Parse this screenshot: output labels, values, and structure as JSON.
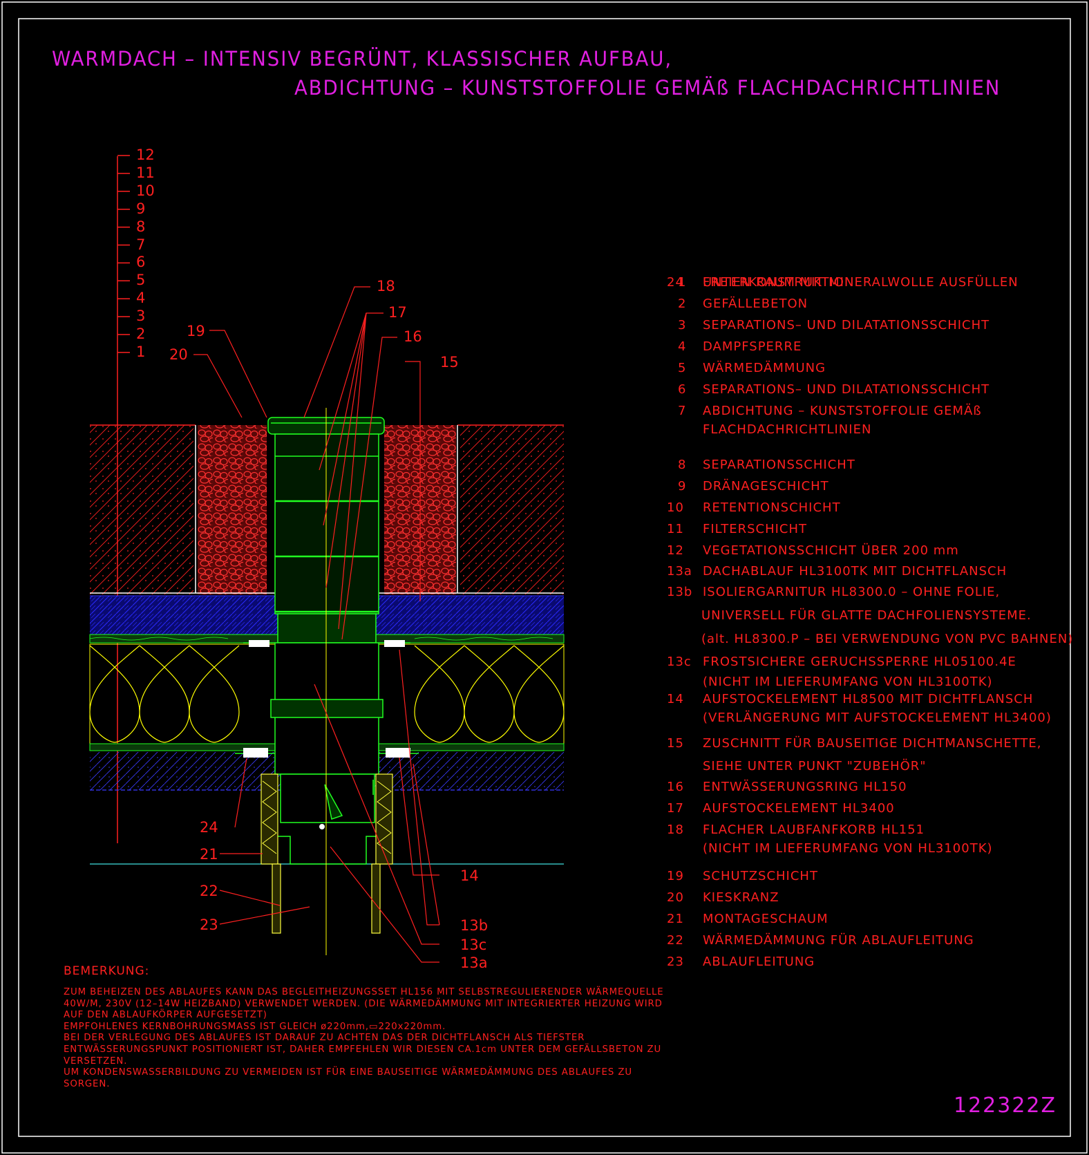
{
  "title": {
    "line1": "WARMDACH – INTENSIV BEGRÜNT, KLASSISCHER AUFBAU,",
    "line2": "ABDICHTUNG – KUNSTSTOFFOLIE GEMÄß FLACHDACHRICHTLINIEN"
  },
  "layer_scale_labels": [
    "12",
    "11",
    "10",
    "9",
    "8",
    "7",
    "6",
    "5",
    "4",
    "3",
    "2",
    "1"
  ],
  "callout_labels": [
    "18",
    "17",
    "16",
    "15",
    "19",
    "20",
    "24",
    "21",
    "22",
    "23",
    "14",
    "13b",
    "13c",
    "13a"
  ],
  "legend": [
    {
      "num": "1",
      "lines": [
        "UNTERKONSTRUKTION"
      ]
    },
    {
      "num": "2",
      "lines": [
        "GEFÄLLEBETON"
      ]
    },
    {
      "num": "3",
      "lines": [
        "SEPARATIONS– UND DILATATIONSSCHICHT"
      ]
    },
    {
      "num": "4",
      "lines": [
        "DAMPFSPERRE"
      ]
    },
    {
      "num": "5",
      "lines": [
        "WÄRMEDÄMMUNG"
      ]
    },
    {
      "num": "6",
      "lines": [
        "SEPARATIONS– UND DILATATIONSSCHICHT"
      ]
    },
    {
      "num": "7",
      "lines": [
        "ABDICHTUNG – KUNSTSTOFFOLIE GEMÄß",
        "FLACHDACHRICHTLINIEN"
      ]
    },
    {
      "num": "8",
      "lines": [
        "SEPARATIONSSCHICHT"
      ]
    },
    {
      "num": "9",
      "lines": [
        "DRÄNAGESCHICHT"
      ]
    },
    {
      "num": "10",
      "lines": [
        "RETENTIONSCHICHT"
      ]
    },
    {
      "num": "11",
      "lines": [
        "FILTERSCHICHT"
      ]
    },
    {
      "num": "12",
      "lines": [
        "VEGETATIONSSCHICHT ÜBER 200 mm"
      ]
    },
    {
      "num": "13a",
      "lines": [
        "DACHABLAUF HL3100TK MIT DICHTFLANSCH"
      ]
    },
    {
      "num": "13b",
      "lines": [
        "ISOLIERGARNITUR HL8300.0 – OHNE FOLIE,",
        "UNIVERSELL FÜR GLATTE DACHFOLIENSYSTEME.",
        "(alt. HL8300.P – BEI VERWENDUNG VON PVC BAHNEN)"
      ]
    },
    {
      "num": "13c",
      "lines": [
        "FROSTSICHERE GERUCHSSPERRE HL05100.4E",
        "(NICHT IM LIEFERUMFANG VON HL3100TK)"
      ]
    },
    {
      "num": "14",
      "lines": [
        "AUFSTOCKELEMENT HL8500 MIT DICHTFLANSCH",
        "(VERLÄNGERUNG MIT AUFSTOCKELEMENT HL3400)"
      ]
    },
    {
      "num": "15",
      "lines": [
        "ZUSCHNITT FÜR BAUSEITIGE DICHTMANSCHETTE,",
        "SIEHE UNTER PUNKT \"ZUBEHÖR\""
      ]
    },
    {
      "num": "16",
      "lines": [
        "ENTWÄSSERUNGSRING HL150"
      ]
    },
    {
      "num": "17",
      "lines": [
        "AUFSTOCKELEMENT HL3400"
      ]
    },
    {
      "num": "18",
      "lines": [
        "FLACHER LAUBFANFKORB HL151",
        "(NICHT IM LIEFERUMFANG VON HL3100TK)"
      ]
    },
    {
      "num": "19",
      "lines": [
        "SCHUTZSCHICHT"
      ]
    },
    {
      "num": "20",
      "lines": [
        "KIESKRANZ"
      ]
    },
    {
      "num": "21",
      "lines": [
        "MONTAGESCHAUM"
      ]
    },
    {
      "num": "22",
      "lines": [
        "WÄRMEDÄMMUNG FÜR ABLAUFLEITUNG"
      ]
    },
    {
      "num": "23",
      "lines": [
        "ABLAUFLEITUNG"
      ]
    },
    {
      "num": "24",
      "lines": [
        "FREIEN RAUM MIT MINERALWOLLE AUSFÜLLEN"
      ]
    }
  ],
  "remark": {
    "title": "BEMERKUNG:",
    "lines": [
      "ZUM BEHEIZEN DES ABLAUFES KANN DAS BEGLEITHEIZUNGSSET HL156 MIT SELBSTREGULIERENDER WÄRMEQUELLE",
      "40W/M, 230V (12–14W HEIZBAND) VERWENDET WERDEN. (DIE WÄRMEDÄMMUNG MIT INTEGRIERTER HEIZUNG WIRD",
      "AUF DEN ABLAUFKÖRPER AUFGESETZT)",
      "EMPFOHLENES KERNBOHRUNGSMASS IST GLEICH ø220mm,▭220x220mm.",
      "BEI DER VERLEGUNG DES ABLAUFES IST DARAUF ZU ACHTEN DAS DER DICHTFLANSCH ALS TIEFSTER",
      "ENTWÄSSERUNGSPUNKT POSITIONIERT IST, DAHER EMPFEHLEN WIR DIESEN CA.1cm UNTER DEM GEFÄLLSBETON ZU",
      "VERSETZEN.",
      "UM KONDENSWASSERBILDUNG ZU VERMEIDEN IST FÜR EINE BAUSEITIGE WÄRMEDÄMMUNG DES ABLAUFES ZU",
      "SORGEN."
    ]
  },
  "drawing_number": "122322Z",
  "colors": {
    "background": "#000000",
    "frame": "#ffffff",
    "title": "#e020e0",
    "text": "#ff2020",
    "soil": "#ff2020",
    "gravel": "#ff3030",
    "drainage": "#2020ff",
    "insulation": "#ffff00",
    "drain_body": "#20ff20",
    "concrete": "#4040ff",
    "pipe_insulation": "#ffff40",
    "axis": "#ffff00",
    "base_line": "#40e0e0"
  }
}
